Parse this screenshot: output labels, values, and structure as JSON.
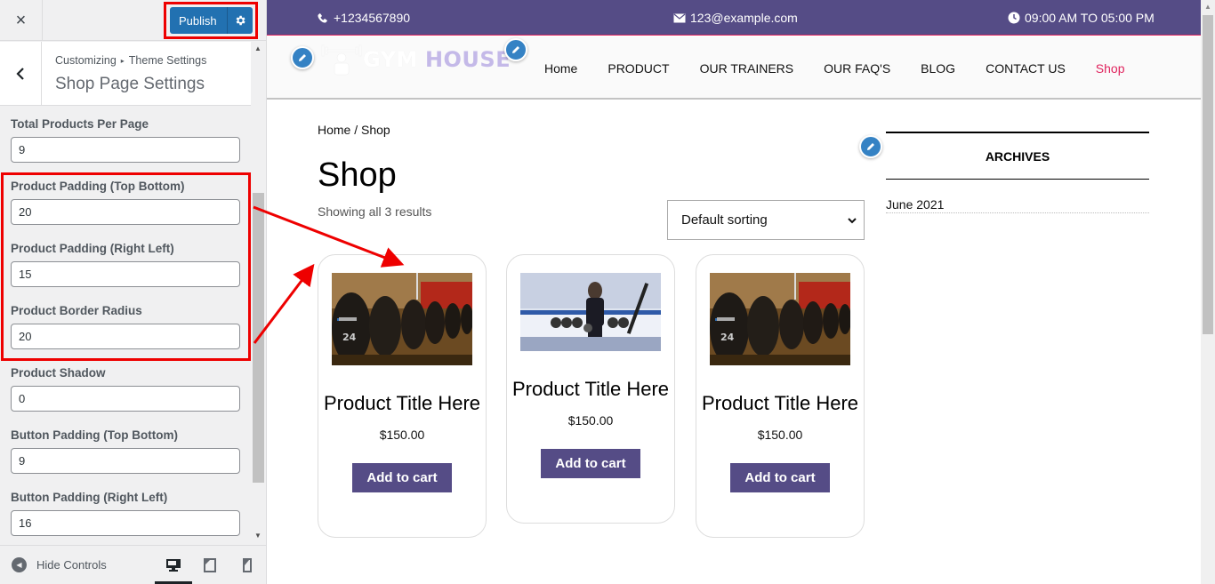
{
  "customizer": {
    "close_label": "×",
    "publish_label": "Publish",
    "breadcrumb": {
      "root": "Customizing",
      "separator": "▸",
      "parent": "Theme Settings"
    },
    "section_title": "Shop Page Settings",
    "controls": [
      {
        "label": "Total Products Per Page",
        "value": "9"
      },
      {
        "label": "Product Padding (Top Bottom)",
        "value": "20"
      },
      {
        "label": "Product Padding (Right Left)",
        "value": "15"
      },
      {
        "label": "Product Border Radius",
        "value": "20"
      },
      {
        "label": "Product Shadow",
        "value": "0"
      },
      {
        "label": "Button Padding (Top Bottom)",
        "value": "9"
      },
      {
        "label": "Button Padding (Right Left)",
        "value": "16"
      }
    ],
    "footer": {
      "hide_controls_label": "Hide Controls",
      "devices": [
        "desktop",
        "tablet",
        "mobile"
      ],
      "active_device": "desktop"
    },
    "highlight_color": "#ee0000"
  },
  "site": {
    "topbar": {
      "phone": "+1234567890",
      "email": "123@example.com",
      "hours": "09:00 AM TO 05:00 PM"
    },
    "logo": {
      "part1": "GYM",
      "part2": "HOUSE"
    },
    "nav": [
      {
        "label": "Home",
        "active": false
      },
      {
        "label": "PRODUCT",
        "active": false
      },
      {
        "label": "OUR TRAINERS",
        "active": false
      },
      {
        "label": "OUR FAQ'S",
        "active": false
      },
      {
        "label": "BLOG",
        "active": false
      },
      {
        "label": "CONTACT US",
        "active": false
      },
      {
        "label": "Shop",
        "active": true
      }
    ],
    "breadcrumb": "Home / Shop",
    "page_title": "Shop",
    "result_count": "Showing all 3 results",
    "sorting": {
      "selected": "Default sorting"
    },
    "products": [
      {
        "image": "dumbbells-rack-photo",
        "title": "Product Title Here",
        "price": "$150.00",
        "button": "Add to cart"
      },
      {
        "image": "woman-gym-photo",
        "title": "Product Title Here",
        "price": "$150.00",
        "button": "Add to cart"
      },
      {
        "image": "dumbbells-rack-photo",
        "title": "Product Title Here",
        "price": "$150.00",
        "button": "Add to cart"
      }
    ],
    "archives": {
      "title": "ARCHIVES",
      "items": [
        "June 2021"
      ]
    },
    "colors": {
      "brand": "#554c86",
      "accent": "#e0245e",
      "edit_pin": "#3582c4",
      "publish": "#2271b1"
    }
  }
}
